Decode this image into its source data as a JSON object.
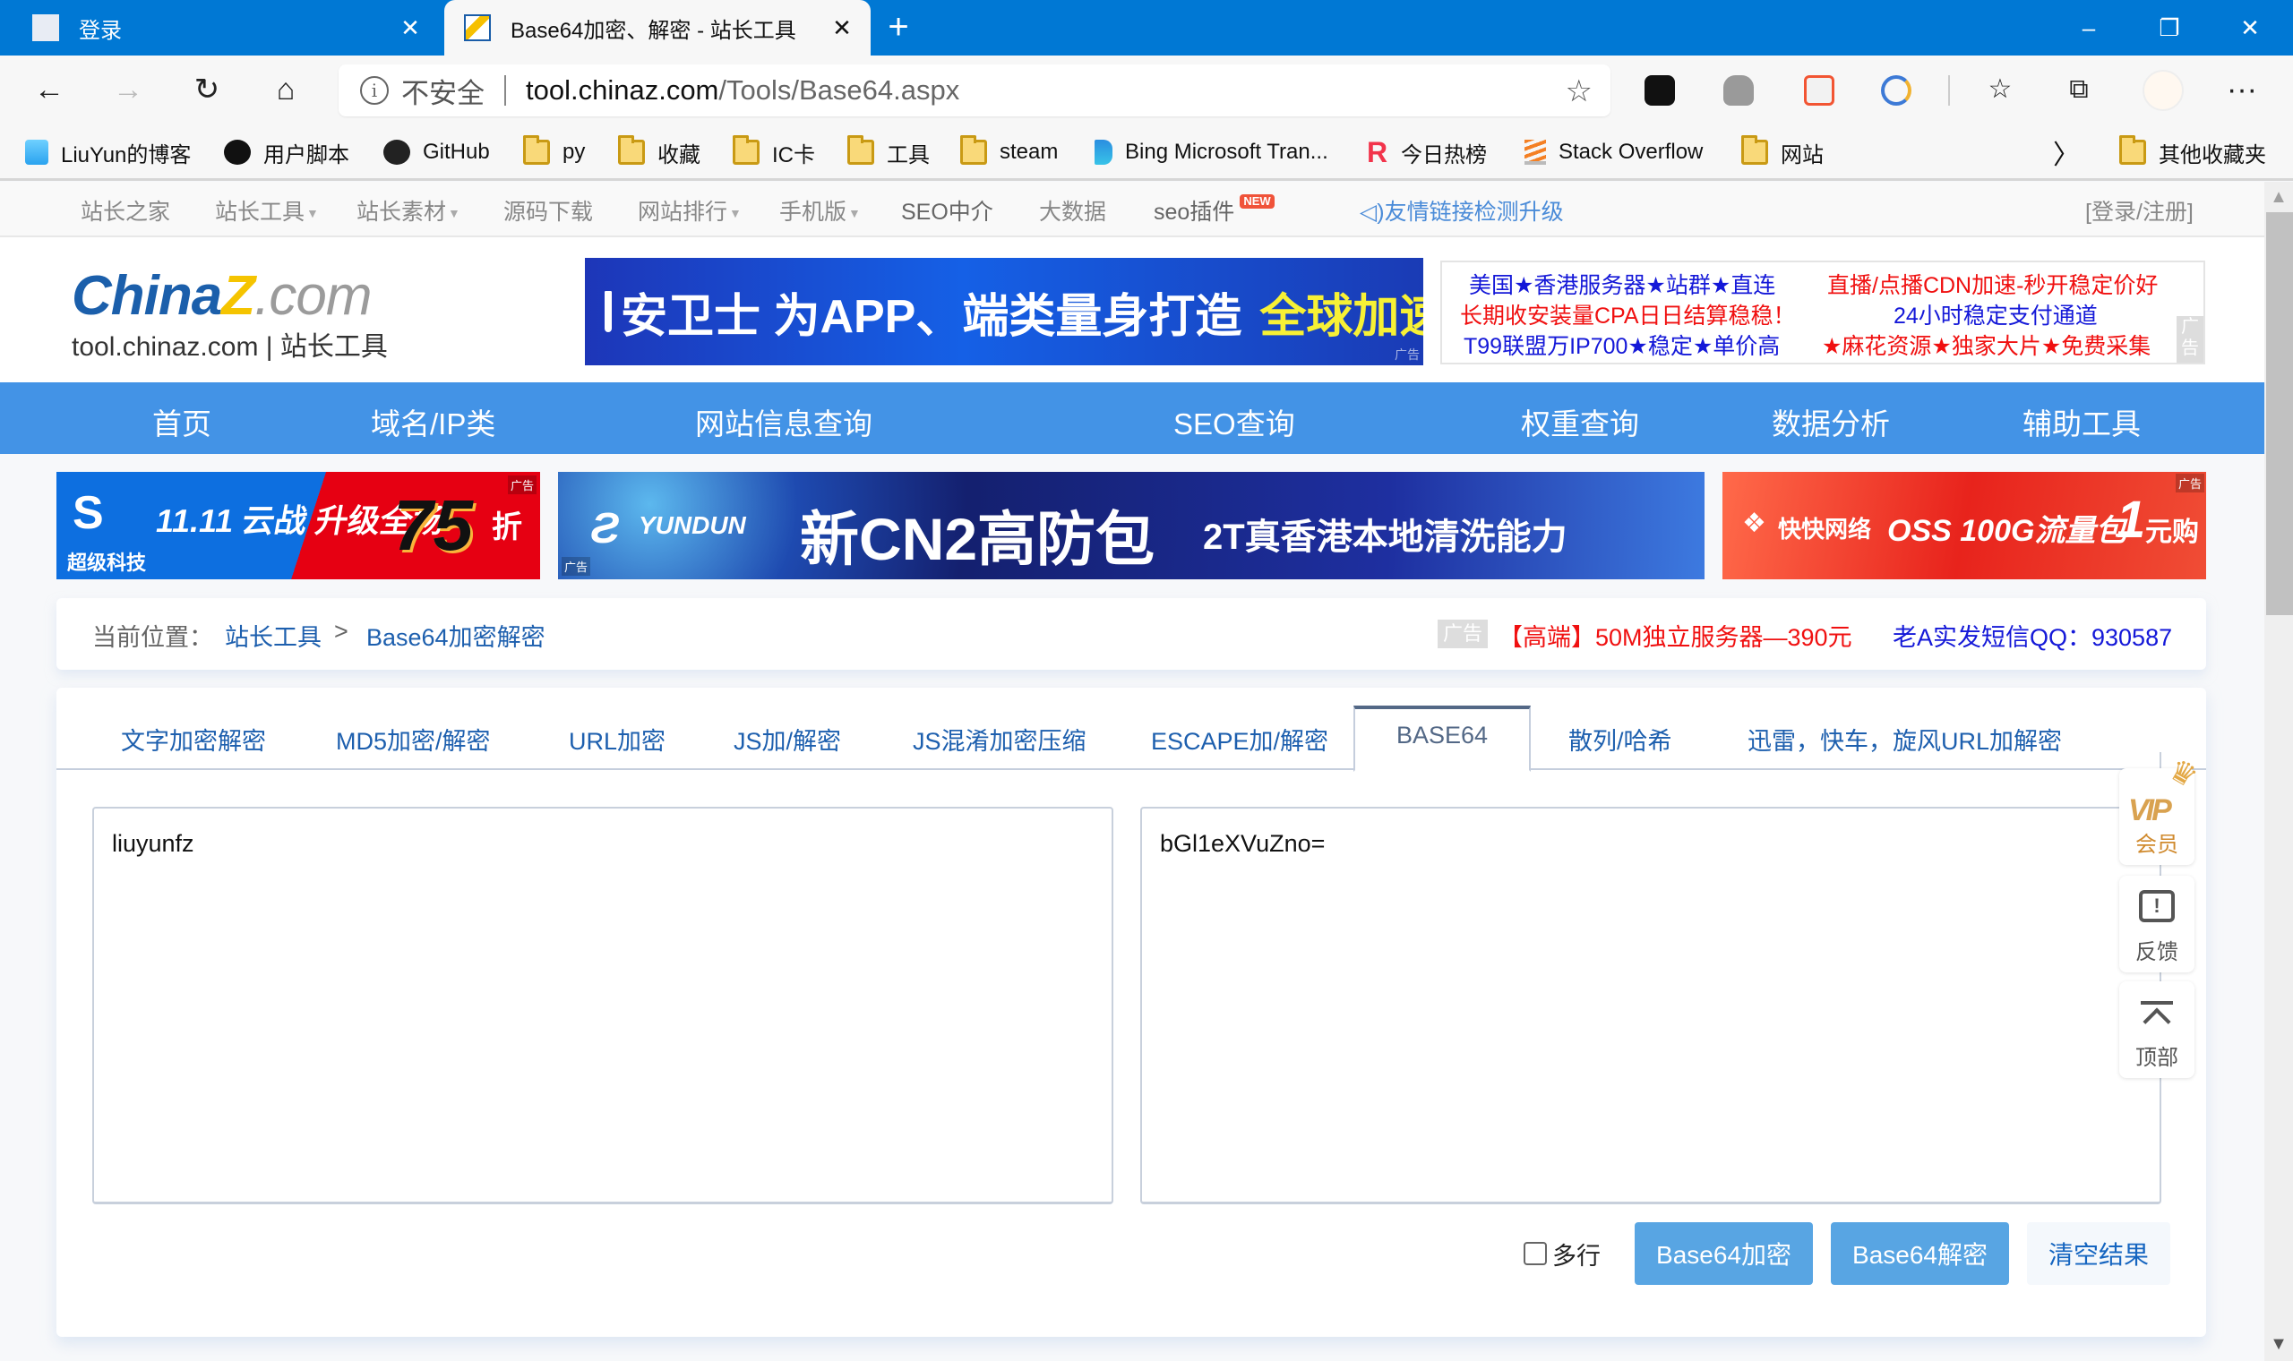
{
  "browser": {
    "tabs": [
      {
        "title": "登录",
        "active": false
      },
      {
        "title": "Base64加密、解密 - 站长工具",
        "active": true
      }
    ],
    "new_tab_label": "+",
    "window_controls": {
      "minimize": "–",
      "restore": "❐",
      "close": "✕"
    },
    "close_glyph": "✕",
    "nav": {
      "back": "←",
      "forward": "→",
      "refresh": "↻",
      "home": "⌂"
    },
    "address": {
      "security_label": "不安全",
      "info_glyph": "i",
      "url_host": "tool.chinaz.com",
      "url_path": "/Tools/Base64.aspx",
      "favorite_glyph": "☆"
    },
    "more_glyph": "···",
    "bookmarks": [
      {
        "label": "LiuYun的博客",
        "icon": "cloud-logo-icon"
      },
      {
        "label": "用户脚本",
        "icon": "tampermonkey-icon"
      },
      {
        "label": "GitHub",
        "icon": "github-icon"
      },
      {
        "label": "py",
        "icon": "folder-icon"
      },
      {
        "label": "收藏",
        "icon": "folder-icon"
      },
      {
        "label": "IC卡",
        "icon": "folder-icon"
      },
      {
        "label": "工具",
        "icon": "folder-icon"
      },
      {
        "label": "steam",
        "icon": "folder-icon"
      },
      {
        "label": "Bing Microsoft Tran...",
        "icon": "bing-icon"
      },
      {
        "label": "今日热榜",
        "icon": "rebang-icon"
      },
      {
        "label": "Stack Overflow",
        "icon": "stackoverflow-icon"
      },
      {
        "label": "网站",
        "icon": "folder-icon"
      }
    ],
    "bookmarks_overflow": "〉",
    "other_bookmarks": "其他收藏夹"
  },
  "site": {
    "top_links": [
      {
        "label": "站长之家",
        "dropdown": false
      },
      {
        "label": "站长工具",
        "dropdown": true
      },
      {
        "label": "站长素材",
        "dropdown": true
      },
      {
        "label": "源码下载",
        "dropdown": false
      },
      {
        "label": "网站排行",
        "dropdown": true
      },
      {
        "label": "手机版",
        "dropdown": true
      },
      {
        "label": "SEO中介",
        "dropdown": false
      },
      {
        "label": "大数据",
        "dropdown": false
      },
      {
        "label": "seo插件",
        "dropdown": false,
        "badge": "NEW"
      }
    ],
    "notice": "友情链接检测升级",
    "login_register": "[登录/注册]",
    "logo": {
      "brand_a": "China",
      "brand_z": "Z",
      "brand_b": ".com",
      "sub": "tool.chinaz.com | 站长工具"
    },
    "header_ad": {
      "text": "安卫士 为APP、端类量身打造",
      "highlight": "全球加速",
      "tag": "广告"
    },
    "text_ads": [
      {
        "text": "美国★香港服务器★站群★直连",
        "color": "blue"
      },
      {
        "text": "直播/点播CDN加速-秒开稳定价好",
        "color": "red"
      },
      {
        "text": "长期收安装量CPA日日结算稳稳！",
        "color": "red"
      },
      {
        "text": "24小时稳定支付通道",
        "color": "blue"
      },
      {
        "text": "T99联盟万IP700★稳定★单价高",
        "color": "blue"
      },
      {
        "text": "★麻花资源★独家大片★免费采集",
        "color": "red"
      }
    ],
    "text_ads_tag": "广告",
    "main_nav": [
      "首页",
      "域名/IP类",
      "网站信息查询",
      "SEO查询",
      "权重查询",
      "数据分析",
      "辅助工具"
    ],
    "banners": [
      {
        "brand": "超级科技",
        "text": "11.11 云战 升级全场",
        "discount": "75",
        "unit": "折",
        "tag": "广告"
      },
      {
        "brand": "YUNDUN",
        "title": "新CN2高防包",
        "subtitle": "2T真香港本地清洗能力",
        "tag": "广告"
      },
      {
        "brand": "快快网络",
        "text": "OSS 100G流量包",
        "price": "1",
        "unit": "元购",
        "tag": "广告"
      }
    ],
    "breadcrumb": {
      "label": "当前位置：",
      "items": [
        "站长工具",
        "Base64加密解密"
      ],
      "separator": ">"
    },
    "breadcrumb_ads": {
      "tag": "广告",
      "red": "【高端】50M独立服务器—390元",
      "blue": "老A实发短信QQ：930587"
    },
    "tool_tabs": [
      {
        "label": "文字加密解密",
        "active": false
      },
      {
        "label": "MD5加密/解密",
        "active": false
      },
      {
        "label": "URL加密",
        "active": false
      },
      {
        "label": "JS加/解密",
        "active": false
      },
      {
        "label": "JS混淆加密压缩",
        "active": false
      },
      {
        "label": "ESCAPE加/解密",
        "active": false
      },
      {
        "label": "BASE64",
        "active": true
      },
      {
        "label": "散列/哈希",
        "active": false
      },
      {
        "label": "迅雷，快车，旋风URL加解密",
        "active": false
      }
    ],
    "tool": {
      "input_value": "liuyunfz",
      "output_value": "bGl1eXVuZno=",
      "multiline_label": "多行",
      "multiline_checked": false,
      "encode_button": "Base64加密",
      "decode_button": "Base64解密",
      "clear_button": "清空结果"
    },
    "side_widgets": [
      {
        "label": "会员",
        "icon": "vip-crown-icon",
        "mark": "VIP"
      },
      {
        "label": "反馈",
        "icon": "feedback-icon",
        "mark": "!"
      },
      {
        "label": "顶部",
        "icon": "back-to-top-icon"
      }
    ]
  },
  "colors": {
    "browser_accent": "#0078d4",
    "nav_blue": "#4393e6",
    "link_blue": "#1d5fae",
    "button_blue": "#58a5e3",
    "ad_red": "#f01010",
    "ad_blue": "#1418d8",
    "vip_gold": "#d08a2e"
  }
}
